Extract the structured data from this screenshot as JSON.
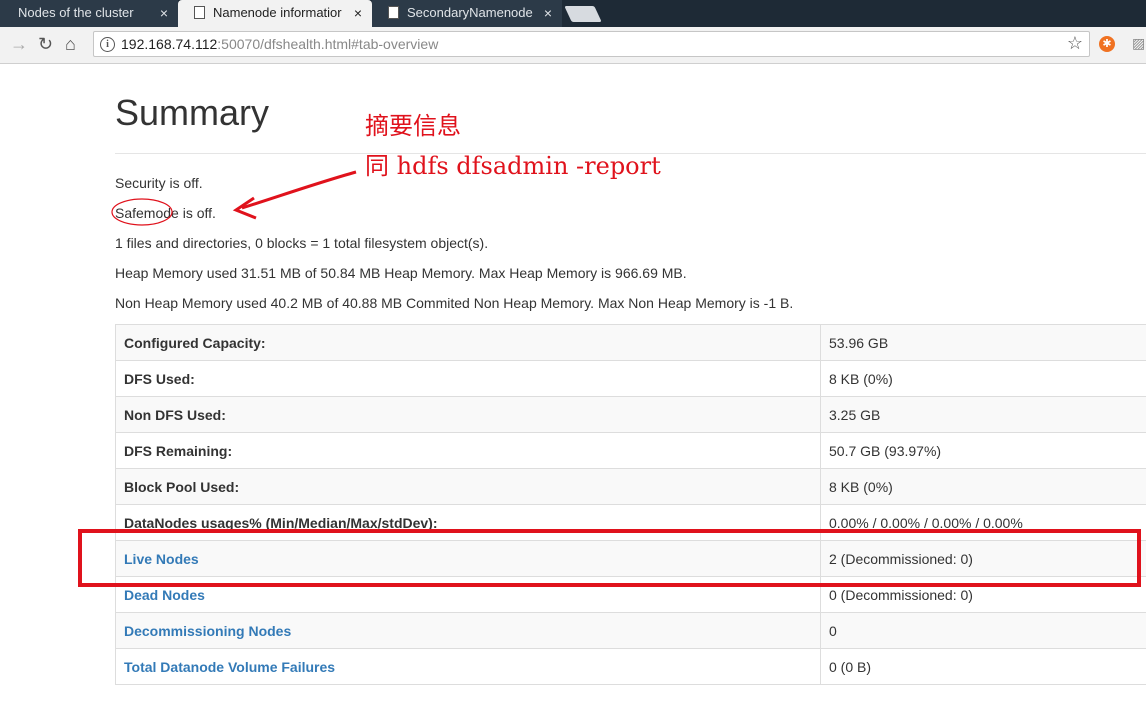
{
  "browser": {
    "tabs": [
      {
        "label": "Nodes of the cluster",
        "close": "×"
      },
      {
        "label": "Namenode informatior",
        "close": "×"
      },
      {
        "label": "SecondaryNamenode i",
        "close": "×"
      }
    ],
    "url_host": "192.168.74.112",
    "url_rest": ":50070/dfshealth.html#tab-overview",
    "icons": [
      "back-icon",
      "reload-icon",
      "home-icon",
      "info-icon",
      "star-icon",
      "extension-icon"
    ]
  },
  "page": {
    "title": "Summary",
    "lines": [
      "Security is off.",
      "Safemode is off.",
      "1 files and directories, 0 blocks = 1 total filesystem object(s).",
      "Heap Memory used 31.51 MB of 50.84 MB Heap Memory. Max Heap Memory is 966.69 MB.",
      "Non Heap Memory used 40.2 MB of 40.88 MB Commited Non Heap Memory. Max Non Heap Memory is -1 B."
    ],
    "rows": [
      {
        "key": "Configured Capacity:",
        "value": "53.96 GB"
      },
      {
        "key": "DFS Used:",
        "value": "8 KB (0%)"
      },
      {
        "key": "Non DFS Used:",
        "value": "3.25 GB"
      },
      {
        "key": "DFS Remaining:",
        "value": "50.7 GB (93.97%)"
      },
      {
        "key": "Block Pool Used:",
        "value": "8 KB (0%)"
      },
      {
        "key": "DataNodes usages% (Min/Median/Max/stdDev):",
        "value": "0.00% / 0.00% / 0.00% / 0.00%"
      },
      {
        "key": "Live Nodes",
        "value": "2 (Decommissioned: 0)"
      },
      {
        "key": "Dead Nodes",
        "value": "0 (Decommissioned: 0)"
      },
      {
        "key": "Decommissioning Nodes",
        "value": "0"
      },
      {
        "key": "Total Datanode Volume Failures",
        "value": "0 (0 B)"
      }
    ]
  },
  "annotations": {
    "line1": "摘要信息",
    "line2": "同 hdfs dfsadmin -report",
    "color": "#e0121c"
  }
}
